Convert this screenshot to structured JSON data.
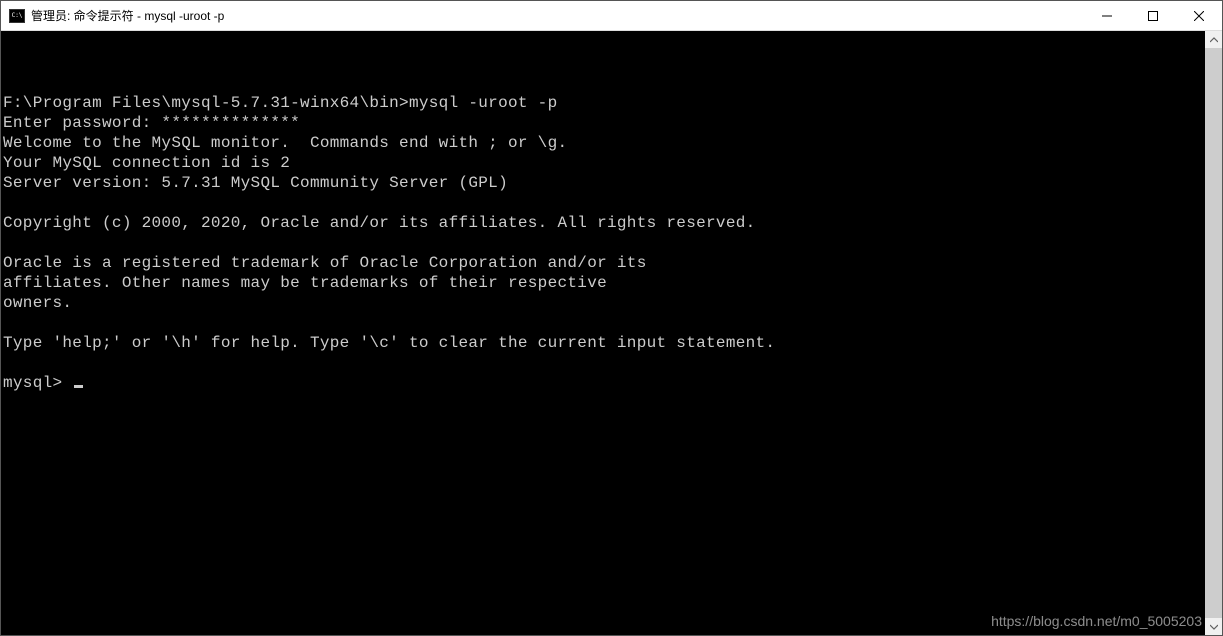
{
  "window": {
    "title": "管理员: 命令提示符 - mysql  -uroot -p"
  },
  "terminal": {
    "lines": [
      "",
      "",
      "",
      "F:\\Program Files\\mysql-5.7.31-winx64\\bin>mysql -uroot -p",
      "Enter password: **************",
      "Welcome to the MySQL monitor.  Commands end with ; or \\g.",
      "Your MySQL connection id is 2",
      "Server version: 5.7.31 MySQL Community Server (GPL)",
      "",
      "Copyright (c) 2000, 2020, Oracle and/or its affiliates. All rights reserved.",
      "",
      "Oracle is a registered trademark of Oracle Corporation and/or its",
      "affiliates. Other names may be trademarks of their respective",
      "owners.",
      "",
      "Type 'help;' or '\\h' for help. Type '\\c' to clear the current input statement.",
      "",
      "mysql> "
    ],
    "cursor_line_index": 17
  },
  "watermark": "https://blog.csdn.net/m0_5005203"
}
